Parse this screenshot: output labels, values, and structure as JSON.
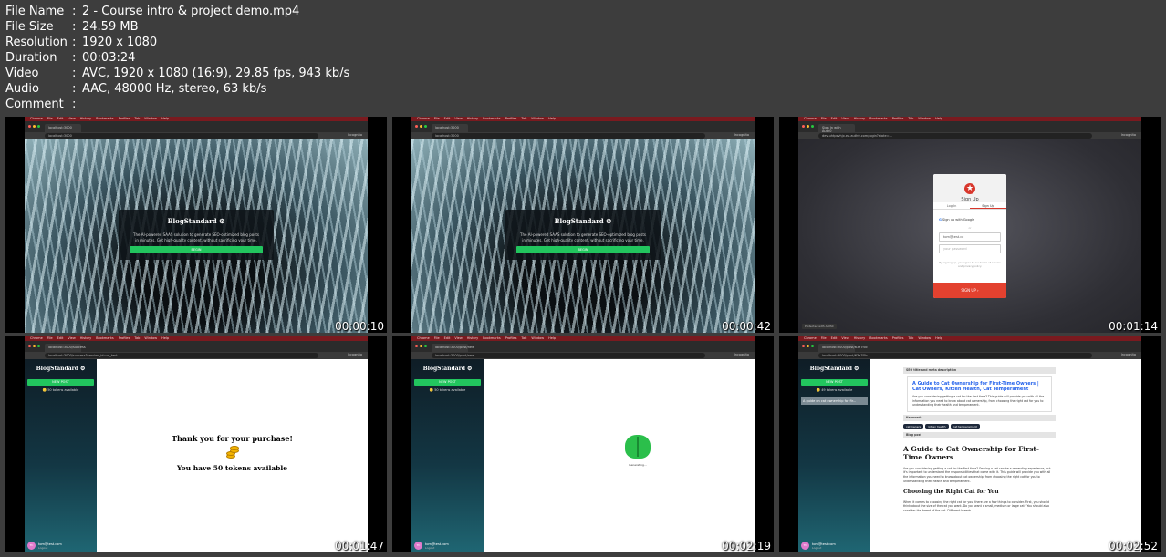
{
  "info": [
    {
      "key": "File Name",
      "value": "2 - Course intro & project demo.mp4"
    },
    {
      "key": "File Size",
      "value": "24.59 MB"
    },
    {
      "key": "Resolution",
      "value": "1920 x 1080"
    },
    {
      "key": "Duration",
      "value": "00:03:24"
    },
    {
      "key": "Video",
      "value": "AVC, 1920 x 1080 (16:9), 29.85 fps, 943 kb/s"
    },
    {
      "key": "Audio",
      "value": "AAC, 48000 Hz, stereo, 63 kb/s"
    },
    {
      "key": "Comment",
      "value": ""
    }
  ],
  "info_colon": ":",
  "thumbs": {
    "t1": {
      "time": "00:00:10"
    },
    "t2": {
      "time": "00:00:42"
    },
    "t3": {
      "time": "00:01:14"
    },
    "t4": {
      "time": "00:01:47"
    },
    "t5": {
      "time": "00:02:19"
    },
    "t6": {
      "time": "00:02:52"
    }
  },
  "browser": {
    "menu": [
      "Chrome",
      "File",
      "Edit",
      "View",
      "History",
      "Bookmarks",
      "Profiles",
      "Tab",
      "Window",
      "Help"
    ],
    "tab_local": "localhost:3000",
    "url_local": "localhost:3000",
    "tab_auth": "Sign In with Auth0",
    "url_auth": "dev-uhtpsvhjx.eu.auth0.com/login?state=...",
    "tab_success": "localhost:3000/success",
    "url_success": "localhost:3000/success?session_id=cs_test",
    "tab_new": "localhost:3000/post/new",
    "url_new": "localhost:3000/post/new",
    "tab_post": "localhost:3000/post/63e7f0c",
    "url_post": "localhost:3000/post/63e7f0c",
    "incognito": "Incognito"
  },
  "landing": {
    "brand": "BlogStandard ⚙",
    "text": "The AI-powered SAAS solution to generate SEO-optimized blog posts in minutes. Get high-quality content, without sacrificing your time.",
    "button": "BEGIN"
  },
  "auth": {
    "title": "Sign Up",
    "tab_login": "Log In",
    "tab_signup": "Sign Up",
    "google": "Sign up with Google",
    "or": "or",
    "email": "tom@test.co",
    "password": "your password",
    "fine": "By signing up, you agree to our terms of service and privacy policy.",
    "button": "SIGN UP ›",
    "badge": "Protected with Auth0"
  },
  "app": {
    "brand": "BlogStandard ⚙",
    "new_post": "NEW POST",
    "tokens_50": "🪙 50 tokens available",
    "tokens_49": "🪙 49 tokens available",
    "post_item": "A guide on cat ownership for fir...",
    "avatar": "TC",
    "email": "tom@test.com",
    "logout": "Logout"
  },
  "thanks": {
    "heading": "Thank you for your purchase!",
    "sub": "You have 50 tokens available"
  },
  "generating": {
    "text": "Generating..."
  },
  "post": {
    "seo_label": "SEO title and meta description",
    "seo_title": "A Guide to Cat Ownership for First-Time Owners | Cat Owners, Kitten Health, Cat Temperament",
    "seo_desc": "Are you considering getting a cat for the first time? This guide will provide you with all the information you need to know about cat ownership, from choosing the right cat for you to understanding their health and temperament.",
    "keywords_label": "Keywords",
    "keywords": [
      "cat owners",
      "kitten health",
      "cat temperament"
    ],
    "blog_label": "Blog post",
    "h1": "A Guide to Cat Ownership for First-Time Owners",
    "p1": "Are you considering getting a cat for the first time? Owning a cat can be a rewarding experience, but it's important to understand the responsibilities that come with it. This guide will provide you with all the information you need to know about cat ownership, from choosing the right cat for you to understanding their health and temperament.",
    "h2": "Choosing the Right Cat for You",
    "p2": "When it comes to choosing the right cat for you, there are a few things to consider. First, you should think about the size of the cat you want. Do you want a small, medium or large cat? You should also consider the breed of the cat. Different breeds"
  },
  "colors": {
    "green": "#22c55e",
    "auth_red": "#e3412f",
    "menubar": "#7a1a1f"
  }
}
